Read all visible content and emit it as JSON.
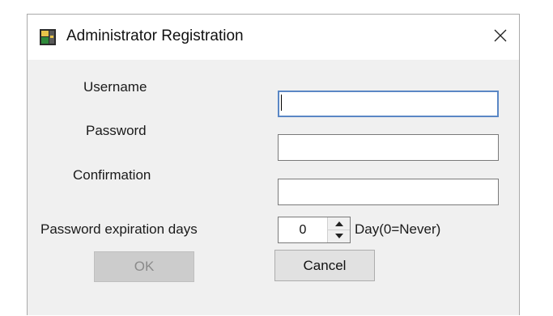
{
  "window": {
    "title": "Administrator Registration",
    "close_glyph": "✕"
  },
  "form": {
    "username_label": "Username",
    "username_value": "",
    "password_label": "Password",
    "password_value": "",
    "confirmation_label": "Confirmation",
    "confirmation_value": "",
    "expiration_label": "Password expiration days",
    "expiration_value": "0",
    "expiration_unit": "Day(0=Never)"
  },
  "buttons": {
    "ok_label": "OK",
    "cancel_label": "Cancel"
  },
  "icons": {
    "title_icon": "app-key-icon",
    "close": "close-icon",
    "spin_up": "spin-up-icon",
    "spin_down": "spin-down-icon"
  },
  "colors": {
    "dialog_bg": "#f0f0f0",
    "focus_border": "#5a87c5",
    "disabled_button": "#cccccc"
  }
}
